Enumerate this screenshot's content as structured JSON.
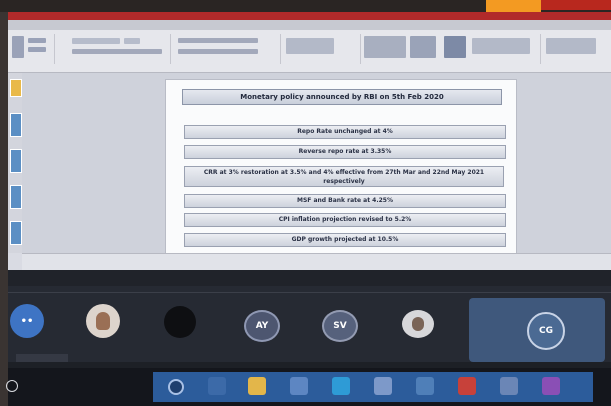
{
  "slide": {
    "title": "Monetary policy announced by RBI on 5th Feb 2020",
    "bullets": [
      "Repo Rate unchanged at 4%",
      "Reverse repo rate at 3.35%",
      "CRR at 3% restoration at 3.5% and 4% effective from 27th Mar and 22nd May 2021 respectively",
      "MSF and Bank rate at 4.25%",
      "CPI inflation projection revised to 5.2%",
      "GDP growth projected at 10.5%"
    ]
  },
  "meeting": {
    "participants": [
      {
        "initials": "AY",
        "color": "#4d5670"
      },
      {
        "initials": "SV",
        "color": "#56617c"
      },
      {
        "initials": "CG",
        "color": "#4b6a93"
      }
    ]
  },
  "colors": {
    "accent_orange": "#f39a22",
    "accent_red": "#b8281e",
    "taskbar_blue": "#2c5c9b"
  }
}
